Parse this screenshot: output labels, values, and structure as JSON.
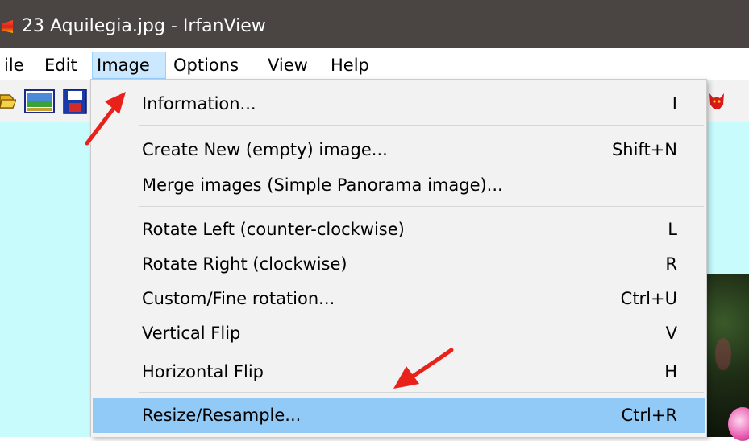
{
  "window": {
    "title": "23 Aquilegia.jpg - IrfanView"
  },
  "menubar": {
    "items": [
      {
        "label": "ile"
      },
      {
        "label": "Edit"
      },
      {
        "label": "Image"
      },
      {
        "label": "Options"
      },
      {
        "label": "View"
      },
      {
        "label": "Help"
      }
    ],
    "active": "Image"
  },
  "toolbar": {
    "icons": [
      "open-folder-icon",
      "slideshow-icon",
      "save-disk-icon",
      "irfanview-cat-icon"
    ]
  },
  "image_menu": {
    "items": [
      {
        "label": "Information...",
        "shortcut": "I"
      },
      {
        "label": "Create New (empty) image...",
        "shortcut": "Shift+N"
      },
      {
        "label": "Merge images (Simple Panorama image)...",
        "shortcut": ""
      },
      {
        "label": "Rotate Left (counter-clockwise)",
        "shortcut": "L"
      },
      {
        "label": "Rotate Right (clockwise)",
        "shortcut": "R"
      },
      {
        "label": "Custom/Fine rotation...",
        "shortcut": "Ctrl+U"
      },
      {
        "label": "Vertical Flip",
        "shortcut": "V"
      },
      {
        "label": "Horizontal Flip",
        "shortcut": "H"
      },
      {
        "label": "Resize/Resample...",
        "shortcut": "Ctrl+R"
      }
    ],
    "highlighted": "Resize/Resample..."
  },
  "colors": {
    "titlebar": "#4a4543",
    "menu_active": "#cce8ff",
    "menu_highlight": "#91c9f7",
    "dropdown_bg": "#f2f2f2",
    "viewer_bg": "#c8fcfc",
    "annotation_arrow": "#e8221a"
  }
}
